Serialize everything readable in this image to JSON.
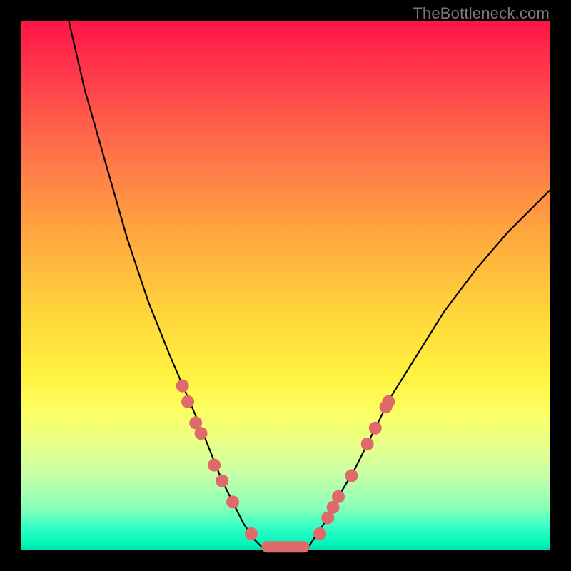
{
  "watermark": "TheBottleneck.com",
  "chart_data": {
    "type": "line",
    "title": "",
    "xlabel": "",
    "ylabel": "",
    "xlim": [
      0,
      100
    ],
    "ylim": [
      0,
      100
    ],
    "grid": false,
    "legend": false,
    "background_gradient": [
      "#ff1547",
      "#ff3a4b",
      "#ff6f4a",
      "#ffa63f",
      "#ffd53a",
      "#fff23f",
      "#fcff64",
      "#e8ff88",
      "#c6ffa8",
      "#8affb9",
      "#2fffc6",
      "#00f5b8",
      "#00e0a8"
    ],
    "series": [
      {
        "name": "left-branch",
        "stroke": "#000000",
        "x": [
          9,
          12,
          16,
          20,
          24,
          28,
          31,
          34,
          36,
          38,
          40,
          42,
          44,
          46
        ],
        "y": [
          100,
          87,
          73,
          59,
          47,
          37,
          30,
          23,
          18,
          13,
          9,
          5,
          2,
          0
        ]
      },
      {
        "name": "right-branch",
        "stroke": "#000000",
        "x": [
          54,
          56,
          58,
          60,
          63,
          66,
          70,
          75,
          80,
          86,
          92,
          100
        ],
        "y": [
          0,
          3,
          6,
          10,
          15,
          21,
          29,
          37,
          45,
          53,
          60,
          68
        ]
      }
    ],
    "floor_segment": {
      "x0": 46,
      "x1": 54,
      "y": 0.5
    },
    "markers_left": [
      {
        "x": 30.5,
        "y": 31
      },
      {
        "x": 31.5,
        "y": 28
      },
      {
        "x": 33.0,
        "y": 24
      },
      {
        "x": 34.0,
        "y": 22
      },
      {
        "x": 36.5,
        "y": 16
      },
      {
        "x": 38.0,
        "y": 13
      },
      {
        "x": 40.0,
        "y": 9
      },
      {
        "x": 43.5,
        "y": 3
      }
    ],
    "markers_right": [
      {
        "x": 56.5,
        "y": 3
      },
      {
        "x": 58.0,
        "y": 6
      },
      {
        "x": 59.0,
        "y": 8
      },
      {
        "x": 60.0,
        "y": 10
      },
      {
        "x": 62.5,
        "y": 14
      },
      {
        "x": 65.5,
        "y": 20
      },
      {
        "x": 67.0,
        "y": 23
      },
      {
        "x": 69.0,
        "y": 27
      },
      {
        "x": 69.5,
        "y": 28
      }
    ]
  }
}
